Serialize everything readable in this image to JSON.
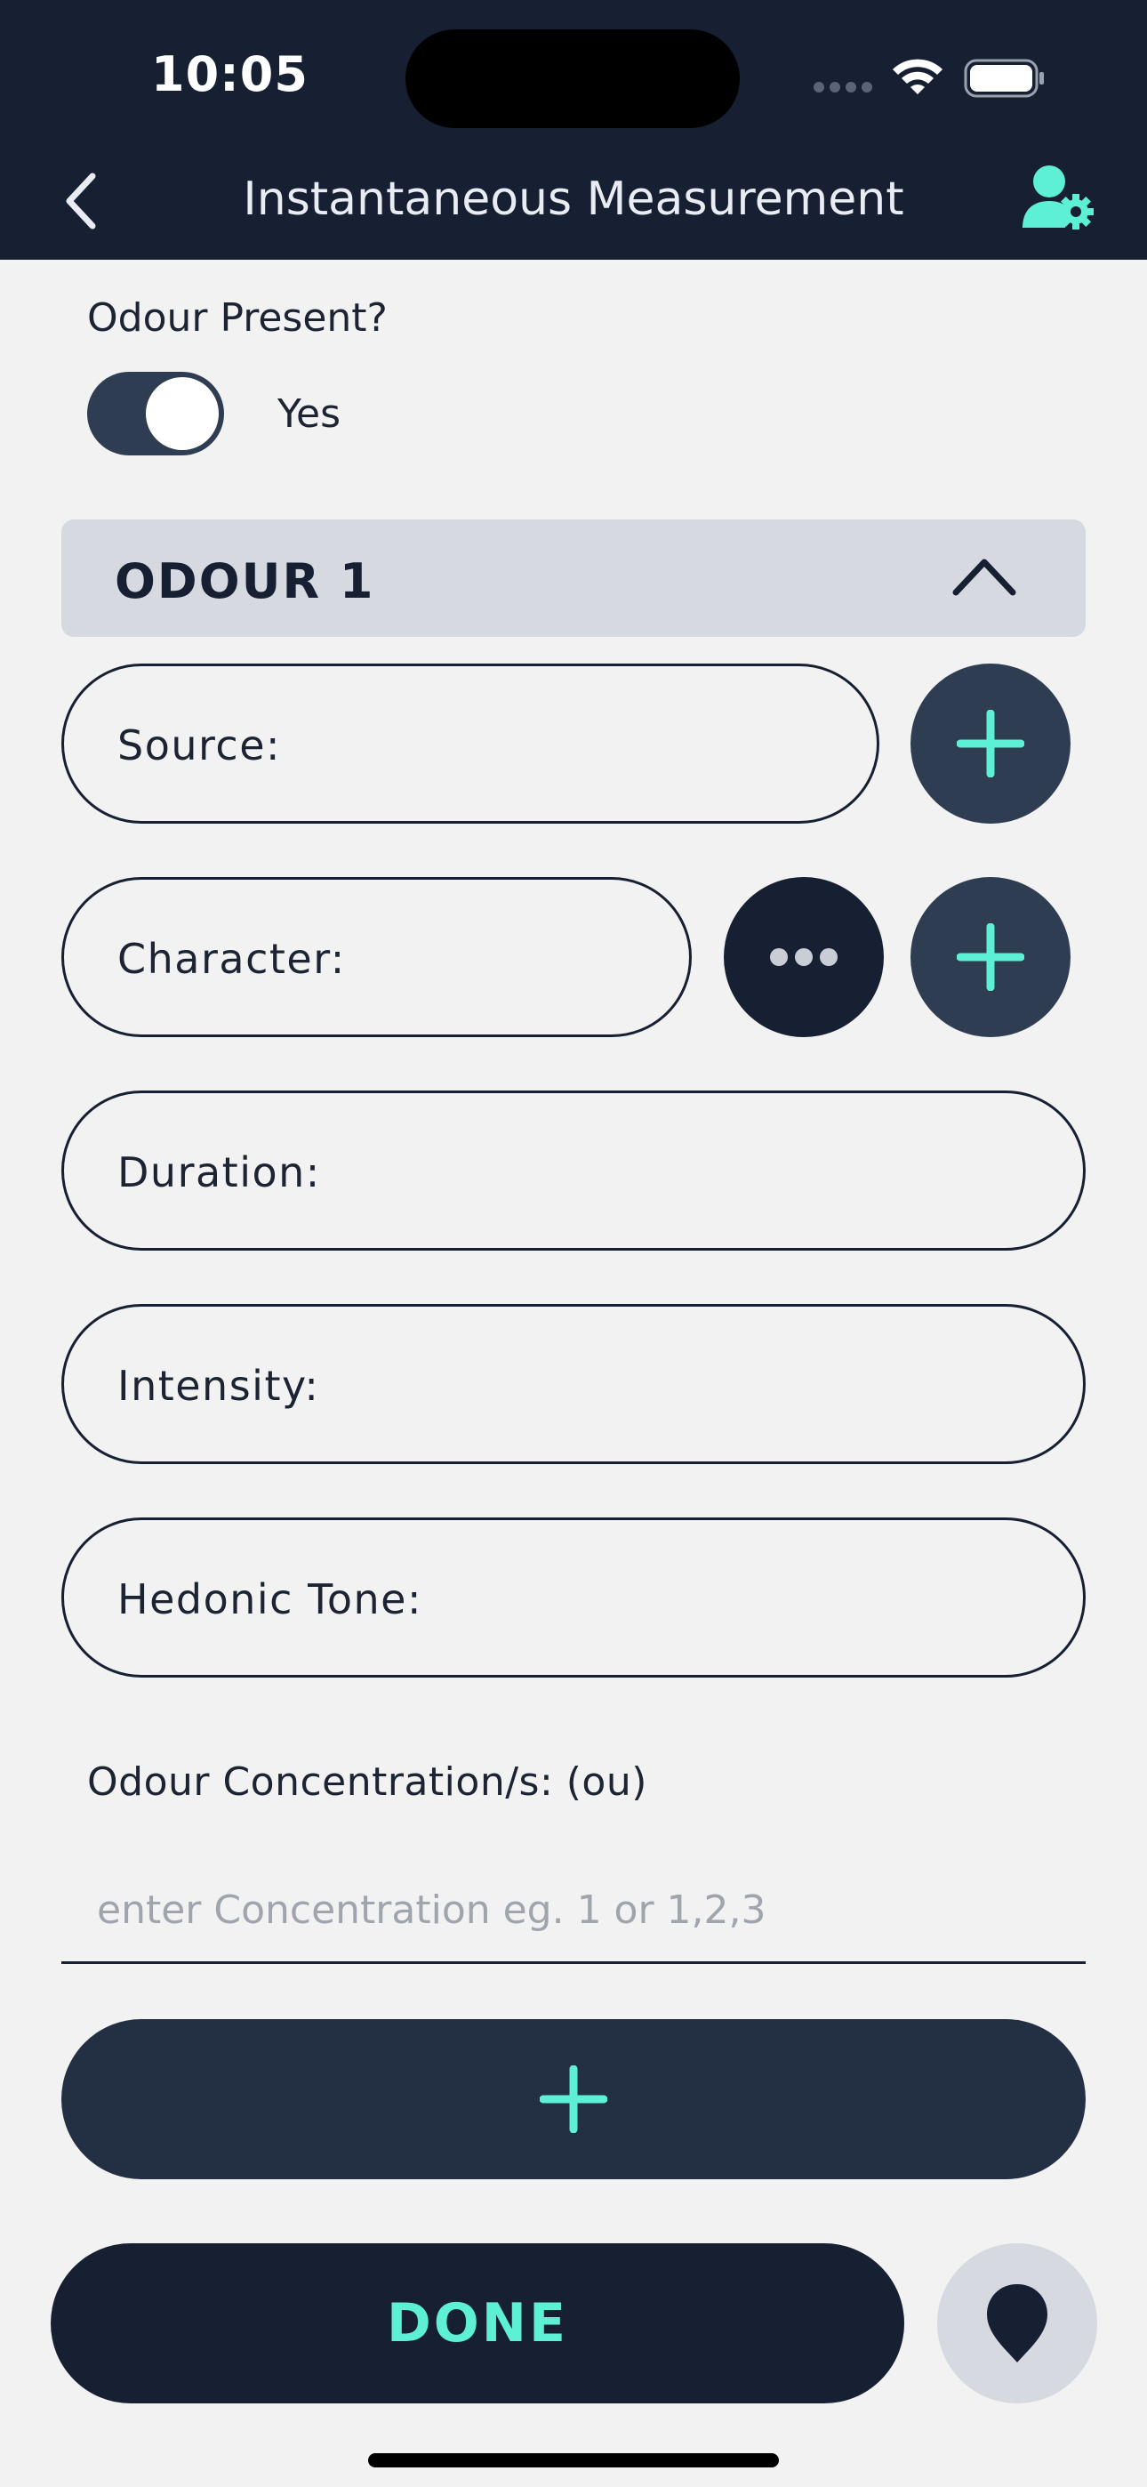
{
  "status_bar": {
    "time": "10:05"
  },
  "header": {
    "title": "Instantaneous Measurement"
  },
  "odour_present": {
    "label": "Odour Present?",
    "value_label": "Yes",
    "checked": true
  },
  "section": {
    "title": "ODOUR 1"
  },
  "fields": {
    "source_label": "Source:",
    "character_label": "Character:",
    "duration_label": "Duration:",
    "intensity_label": "Intensity:",
    "hedonic_tone_label": "Hedonic Tone:"
  },
  "concentration": {
    "label": "Odour Concentration/s: (ou)",
    "placeholder": "enter Concentration eg. 1 or 1,2,3",
    "value": ""
  },
  "footer": {
    "done_label": "DONE"
  },
  "icons": {
    "back": "chevron-left-icon",
    "user_settings": "user-gear-icon",
    "collapse": "chevron-up-icon",
    "add": "plus-icon",
    "more": "ellipsis-icon",
    "location": "map-pin-icon"
  },
  "colors": {
    "header_bg": "#162032",
    "accent": "#5ef0d6",
    "button_dark": "#2f3d52",
    "section_bg": "#d6d9e0",
    "page_bg": "#f2f2f2"
  }
}
